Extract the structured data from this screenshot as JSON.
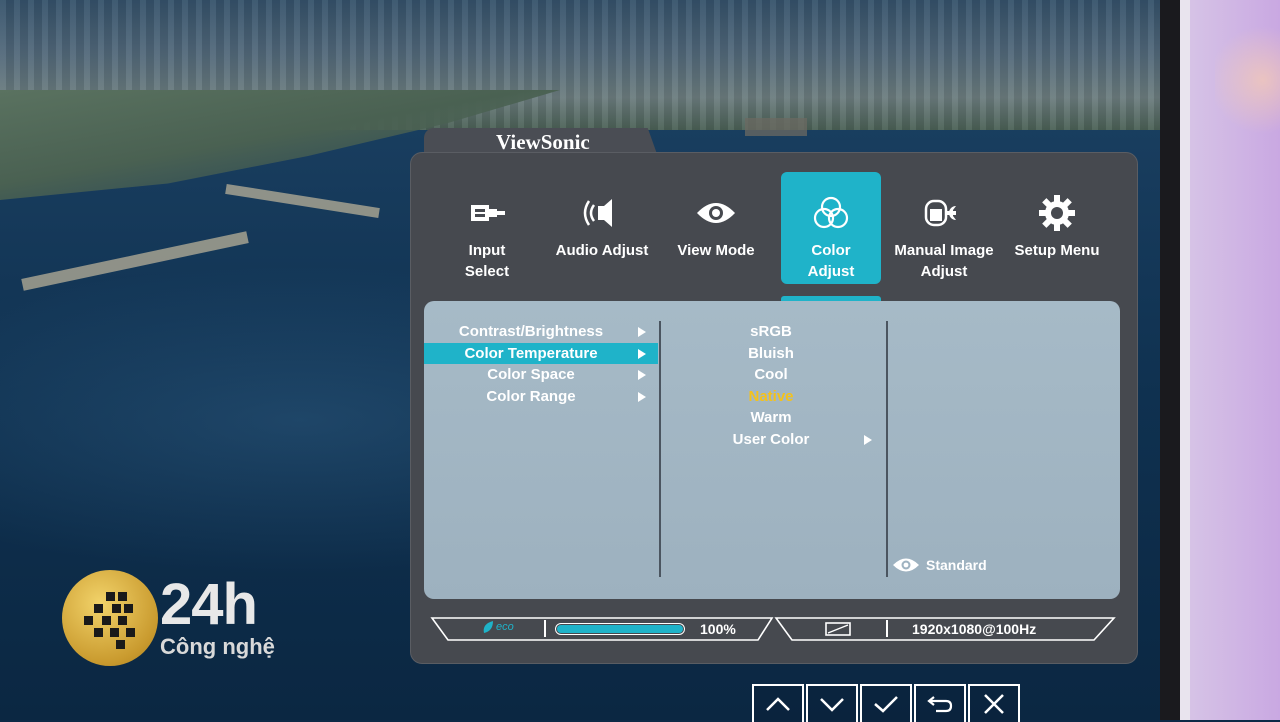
{
  "osd": {
    "brand": "ViewSonic",
    "nav": [
      {
        "id": "input-select",
        "label_line1": "Input",
        "label_line2": "Select",
        "icon": "input-select-icon",
        "active": false
      },
      {
        "id": "audio-adjust",
        "label_line1": "Audio Adjust",
        "label_line2": "",
        "icon": "speaker-icon",
        "active": false
      },
      {
        "id": "view-mode",
        "label_line1": "View Mode",
        "label_line2": "",
        "icon": "eye-icon",
        "active": false
      },
      {
        "id": "color-adjust",
        "label_line1": "Color",
        "label_line2": "Adjust",
        "icon": "color-circles-icon",
        "active": true
      },
      {
        "id": "manual-image-adjust",
        "label_line1": "Manual Image",
        "label_line2": "Adjust",
        "icon": "image-wrench-icon",
        "active": false
      },
      {
        "id": "setup-menu",
        "label_line1": "Setup Menu",
        "label_line2": "",
        "icon": "gear-icon",
        "active": false
      }
    ],
    "submenu": [
      {
        "label": "Contrast/Brightness",
        "selected": false
      },
      {
        "label": "Color Temperature",
        "selected": true
      },
      {
        "label": "Color Space",
        "selected": false
      },
      {
        "label": "Color Range",
        "selected": false
      }
    ],
    "options": [
      {
        "label": "sRGB",
        "current": false,
        "has_sub": false
      },
      {
        "label": "Bluish",
        "current": false,
        "has_sub": false
      },
      {
        "label": "Cool",
        "current": false,
        "has_sub": false
      },
      {
        "label": "Native",
        "current": true,
        "has_sub": false
      },
      {
        "label": "Warm",
        "current": false,
        "has_sub": false
      },
      {
        "label": "User Color",
        "current": false,
        "has_sub": true
      }
    ],
    "view_mode_indicator": "Standard",
    "status": {
      "eco_label": "eco",
      "brightness_level": 100,
      "brightness_text": "100%",
      "resolution": "1920x1080@100Hz"
    },
    "colors": {
      "accent": "#1fb3c9",
      "current_option": "#f4c21b",
      "panel": "#9fb3c1",
      "frame": "#46494f"
    }
  },
  "watermark": {
    "number": "24h",
    "subtitle": "Công nghệ"
  },
  "keys": [
    {
      "id": "up",
      "icon": "chevron-up-icon"
    },
    {
      "id": "down",
      "icon": "chevron-down-icon"
    },
    {
      "id": "ok",
      "icon": "check-icon"
    },
    {
      "id": "back",
      "icon": "return-icon"
    },
    {
      "id": "close",
      "icon": "close-icon"
    }
  ]
}
